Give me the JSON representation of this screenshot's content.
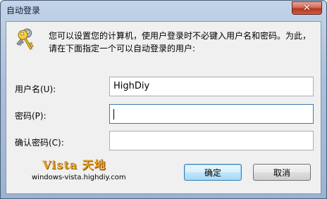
{
  "window": {
    "title": "自动登录",
    "close_glyph": "✕"
  },
  "description": "您可以设置您的计算机，使用户登录时不必键入用户名和密码。为此，请在下面指定一个可以自动登录的用户:",
  "form": {
    "username_label": "用户名(U):",
    "username_value": "HighDiy",
    "password_label": "密码(P):",
    "password_value": "",
    "confirm_label": "确认密码(C):",
    "confirm_value": ""
  },
  "watermark": {
    "brand": "Vista 天地",
    "url": "windows-vista.highdiy.com"
  },
  "buttons": {
    "ok_label": "确定",
    "cancel_label": "取消"
  },
  "icons": {
    "keys": "keys-icon",
    "close": "close-icon"
  }
}
